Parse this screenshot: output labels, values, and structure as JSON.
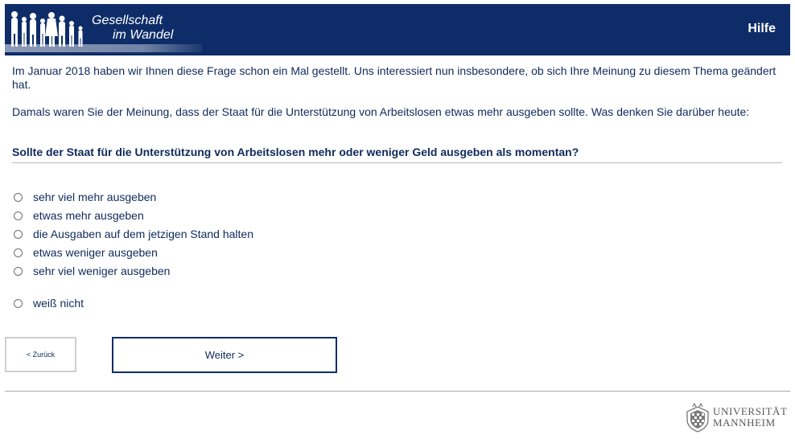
{
  "header": {
    "brand_line1": "Gesellschaft",
    "brand_line2": "im Wandel",
    "help_label": "Hilfe",
    "bg_color": "#0e2d68"
  },
  "content": {
    "intro_1": "Im Januar 2018 haben wir Ihnen diese Frage schon ein Mal gestellt. Uns interessiert nun insbesondere, ob sich Ihre Meinung zu diesem Thema geändert hat.",
    "intro_2": "Damals waren Sie der Meinung, dass der Staat für die Unterstützung von Arbeitslosen etwas mehr ausgeben sollte. Was denken Sie darüber heute:",
    "question": "Sollte der Staat für die Unterstützung von Arbeitslosen mehr oder weniger Geld ausgeben als momentan?"
  },
  "options": [
    {
      "label": "sehr viel mehr ausgeben"
    },
    {
      "label": "etwas mehr ausgeben"
    },
    {
      "label": "die Ausgaben auf dem jetzigen Stand halten"
    },
    {
      "label": "etwas weniger ausgeben"
    },
    {
      "label": "sehr viel weniger ausgeben"
    },
    {
      "label": "weiß nicht"
    }
  ],
  "navigation": {
    "back_label": "< Zurück",
    "next_label": "Weiter >"
  },
  "footer": {
    "university_line1": "UNIVERSITÄT",
    "university_line2": "MANNHEIM"
  },
  "icons": {
    "logo": "people-silhouettes-icon",
    "crest": "university-crest-icon"
  }
}
